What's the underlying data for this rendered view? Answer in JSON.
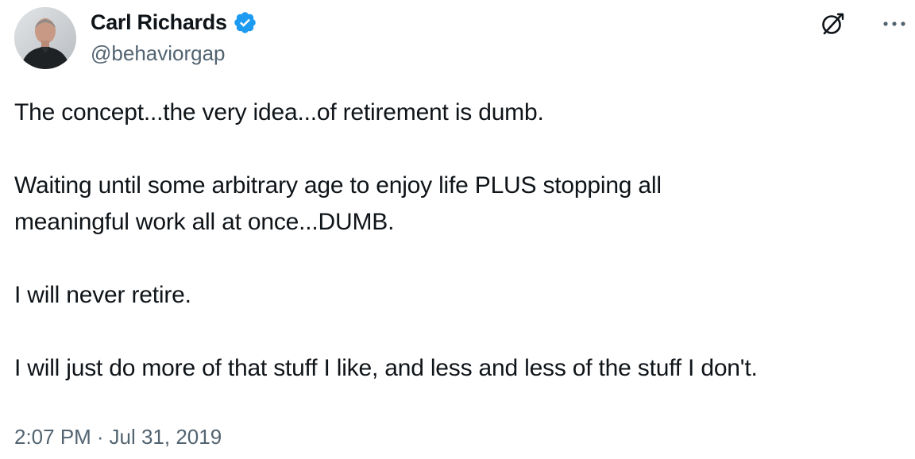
{
  "author": {
    "display_name": "Carl Richards",
    "handle": "@behaviorgap",
    "verified_icon": "verified-badge-icon",
    "avatar_icon": "profile-avatar"
  },
  "header_actions": {
    "grok_icon": "grok-icon",
    "more_icon": "more-options-icon"
  },
  "tweet": {
    "paragraphs": [
      "The concept...the very idea...of retirement is dumb.",
      "Waiting until some arbitrary age to enjoy life PLUS stopping all",
      "meaningful work all at once...DUMB.",
      "I will never retire.",
      "I will just do more of that stuff I like, and less and less of the stuff I don't."
    ]
  },
  "meta": {
    "time": "2:07 PM",
    "separator": "·",
    "date": "Jul 31, 2019"
  },
  "colors": {
    "text_primary": "#0f1419",
    "text_secondary": "#536471",
    "verified_blue": "#1d9bf0"
  }
}
